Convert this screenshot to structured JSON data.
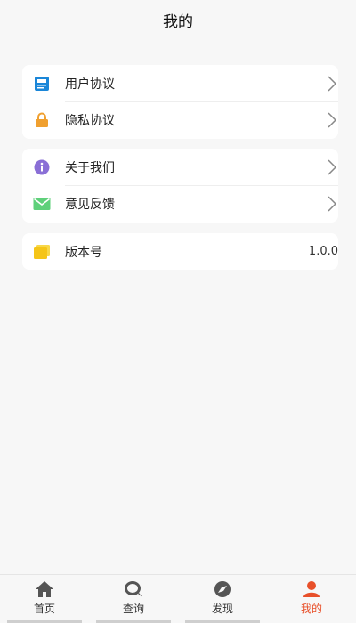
{
  "header": {
    "title": "我的"
  },
  "groups": [
    {
      "items": [
        {
          "label": "用户协议",
          "icon": "document-icon",
          "color": "#1a86d8"
        },
        {
          "label": "隐私协议",
          "icon": "lock-icon",
          "color": "#f0a030"
        }
      ]
    },
    {
      "items": [
        {
          "label": "关于我们",
          "icon": "info-icon",
          "color": "#8a6fd6"
        },
        {
          "label": "意见反馈",
          "icon": "mail-icon",
          "color": "#5ed07a"
        }
      ]
    },
    {
      "items": [
        {
          "label": "版本号",
          "icon": "folder-icon",
          "color": "#f5c518",
          "value": "1.0.0"
        }
      ]
    }
  ],
  "tabbar": {
    "tabs": [
      {
        "label": "首页",
        "icon": "home-icon"
      },
      {
        "label": "查询",
        "icon": "chat-search-icon"
      },
      {
        "label": "发现",
        "icon": "discover-icon"
      },
      {
        "label": "我的",
        "icon": "user-icon",
        "active": true
      }
    ],
    "accent": "#e8502a"
  }
}
